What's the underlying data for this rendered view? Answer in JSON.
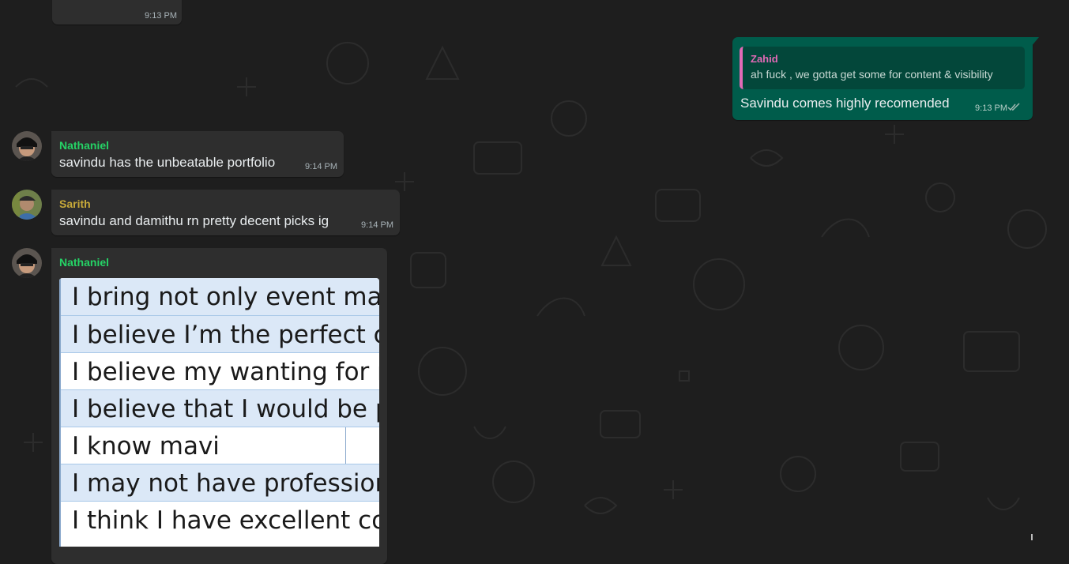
{
  "colors": {
    "background": "#1e1e1e",
    "incoming_bubble": "#2e2e2e",
    "outgoing_bubble": "#005c4b",
    "nathaniel_name": "#25d366",
    "sarith_name": "#c7a939",
    "zahid_name": "#e26ab6",
    "sheet_highlight_row": "#dbe8f7"
  },
  "top_message": {
    "time": "9:13 PM"
  },
  "outgoing": {
    "quote": {
      "author": "Zahid",
      "text": "ah fuck , we gotta get some for content & visibility"
    },
    "text": "Savindu comes highly recomended",
    "time": "9:13 PM",
    "status_icon": "double-check-icon"
  },
  "messages": [
    {
      "sender": "Nathaniel",
      "text": "savindu has the unbeatable portfolio",
      "time": "9:14 PM"
    },
    {
      "sender": "Sarith",
      "text": "savindu and damithu rn pretty decent picks ig",
      "time": "9:14 PM"
    },
    {
      "sender": "Nathaniel",
      "image": {
        "rows": [
          "I bring not only event mana",
          "I believe I’m the perfect car",
          "I believe my wanting  for no",
          "I believe that I would be pe",
          "I know mavi",
          "I may not have professiona",
          "I think I have excellent com"
        ]
      }
    }
  ]
}
